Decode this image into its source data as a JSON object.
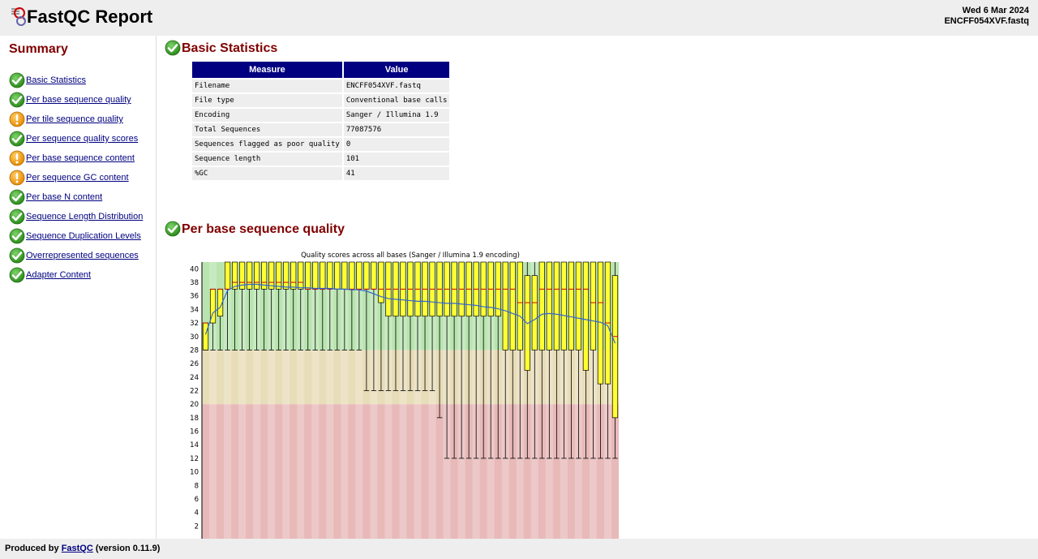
{
  "header": {
    "title": "FastQC Report",
    "date": "Wed 6 Mar 2024",
    "filename": "ENCFF054XVF.fastq"
  },
  "summary": {
    "title": "Summary",
    "items": [
      {
        "label": "Basic Statistics",
        "status": "pass"
      },
      {
        "label": "Per base sequence quality",
        "status": "pass"
      },
      {
        "label": "Per tile sequence quality",
        "status": "warn"
      },
      {
        "label": "Per sequence quality scores",
        "status": "pass"
      },
      {
        "label": "Per base sequence content",
        "status": "warn"
      },
      {
        "label": "Per sequence GC content",
        "status": "warn"
      },
      {
        "label": "Per base N content",
        "status": "pass"
      },
      {
        "label": "Sequence Length Distribution",
        "status": "pass"
      },
      {
        "label": "Sequence Duplication Levels",
        "status": "pass"
      },
      {
        "label": "Overrepresented sequences",
        "status": "pass"
      },
      {
        "label": "Adapter Content",
        "status": "pass"
      }
    ]
  },
  "basic_statistics": {
    "title": "Basic Statistics",
    "headers": [
      "Measure",
      "Value"
    ],
    "rows": [
      [
        "Filename",
        "ENCFF054XVF.fastq"
      ],
      [
        "File type",
        "Conventional base calls"
      ],
      [
        "Encoding",
        "Sanger / Illumina 1.9"
      ],
      [
        "Total Sequences",
        "77087576"
      ],
      [
        "Sequences flagged as poor quality",
        "0"
      ],
      [
        "Sequence length",
        "101"
      ],
      [
        "%GC",
        "41"
      ]
    ]
  },
  "per_base_quality": {
    "title": "Per base sequence quality"
  },
  "chart_data": {
    "type": "box",
    "title": "Quality scores across all bases (Sanger / Illumina 1.9 encoding)",
    "y_ticks": [
      2,
      4,
      6,
      8,
      10,
      12,
      14,
      16,
      18,
      20,
      22,
      24,
      26,
      28,
      30,
      32,
      34,
      36,
      38,
      40
    ],
    "ylim": [
      0,
      41
    ],
    "zones": [
      {
        "from": 28,
        "to": 41,
        "color": "#b9e4b0"
      },
      {
        "from": 20,
        "to": 28,
        "color": "#e8ddb9"
      },
      {
        "from": 0,
        "to": 20,
        "color": "#e8b9b9"
      }
    ],
    "box_color": "#ffff33",
    "median_color": "#cc0000",
    "mean_color": "#3366cc",
    "positions": [
      {
        "lo": 28,
        "q1": 28,
        "med": 32,
        "q3": 32,
        "hi": 32,
        "mean": 30.3
      },
      {
        "lo": 28,
        "q1": 32,
        "med": 37,
        "q3": 37,
        "hi": 37,
        "mean": 33.5
      },
      {
        "lo": 28,
        "q1": 33,
        "med": 37,
        "q3": 37,
        "hi": 37,
        "mean": 34.3
      },
      {
        "lo": 28,
        "q1": 37,
        "med": 37,
        "q3": 41,
        "hi": 41,
        "mean": 36.8
      },
      {
        "lo": 28,
        "q1": 37,
        "med": 38,
        "q3": 41,
        "hi": 41,
        "mean": 37.4
      },
      {
        "lo": 28,
        "q1": 37,
        "med": 38,
        "q3": 41,
        "hi": 41,
        "mean": 37.6
      },
      {
        "lo": 28,
        "q1": 37,
        "med": 38,
        "q3": 41,
        "hi": 41,
        "mean": 37.7
      },
      {
        "lo": 28,
        "q1": 37,
        "med": 38,
        "q3": 41,
        "hi": 41,
        "mean": 37.7
      },
      {
        "lo": 28,
        "q1": 37,
        "med": 38,
        "q3": 41,
        "hi": 41,
        "mean": 37.6
      },
      {
        "lo": 28,
        "q1": 37,
        "med": 38,
        "q3": 41,
        "hi": 41,
        "mean": 37.5
      },
      {
        "lo": 28,
        "q1": 37,
        "med": 38,
        "q3": 41,
        "hi": 41,
        "mean": 37.4
      },
      {
        "lo": 28,
        "q1": 37,
        "med": 38,
        "q3": 41,
        "hi": 41,
        "mean": 37.3
      },
      {
        "lo": 28,
        "q1": 37,
        "med": 38,
        "q3": 41,
        "hi": 41,
        "mean": 37.3
      },
      {
        "lo": 28,
        "q1": 37,
        "med": 38,
        "q3": 41,
        "hi": 41,
        "mean": 37.2
      },
      {
        "lo": 28,
        "q1": 37,
        "med": 37,
        "q3": 41,
        "hi": 41,
        "mean": 37.2
      },
      {
        "lo": 28,
        "q1": 37,
        "med": 37,
        "q3": 41,
        "hi": 41,
        "mean": 37.1
      },
      {
        "lo": 28,
        "q1": 37,
        "med": 37,
        "q3": 41,
        "hi": 41,
        "mean": 37.1
      },
      {
        "lo": 28,
        "q1": 37,
        "med": 37,
        "q3": 41,
        "hi": 41,
        "mean": 37.1
      },
      {
        "lo": 28,
        "q1": 37,
        "med": 37,
        "q3": 41,
        "hi": 41,
        "mean": 37.0
      },
      {
        "lo": 28,
        "q1": 37,
        "med": 37,
        "q3": 41,
        "hi": 41,
        "mean": 37.0
      },
      {
        "lo": 28,
        "q1": 37,
        "med": 37,
        "q3": 41,
        "hi": 41,
        "mean": 36.9
      },
      {
        "lo": 28,
        "q1": 37,
        "med": 37,
        "q3": 41,
        "hi": 41,
        "mean": 36.9
      },
      {
        "lo": 22,
        "q1": 37,
        "med": 37,
        "q3": 41,
        "hi": 41,
        "mean": 36.7
      },
      {
        "lo": 22,
        "q1": 37,
        "med": 37,
        "q3": 41,
        "hi": 41,
        "mean": 36.3
      },
      {
        "lo": 22,
        "q1": 35,
        "med": 37,
        "q3": 41,
        "hi": 41,
        "mean": 35.9
      },
      {
        "lo": 22,
        "q1": 33,
        "med": 37,
        "q3": 41,
        "hi": 41,
        "mean": 35.6
      },
      {
        "lo": 22,
        "q1": 33,
        "med": 37,
        "q3": 41,
        "hi": 41,
        "mean": 35.5
      },
      {
        "lo": 22,
        "q1": 33,
        "med": 37,
        "q3": 41,
        "hi": 41,
        "mean": 35.4
      },
      {
        "lo": 22,
        "q1": 33,
        "med": 37,
        "q3": 41,
        "hi": 41,
        "mean": 35.3
      },
      {
        "lo": 22,
        "q1": 33,
        "med": 37,
        "q3": 41,
        "hi": 41,
        "mean": 35.2
      },
      {
        "lo": 22,
        "q1": 33,
        "med": 37,
        "q3": 41,
        "hi": 41,
        "mean": 35.2
      },
      {
        "lo": 22,
        "q1": 33,
        "med": 37,
        "q3": 41,
        "hi": 41,
        "mean": 35.1
      },
      {
        "lo": 18,
        "q1": 33,
        "med": 37,
        "q3": 41,
        "hi": 41,
        "mean": 35.0
      },
      {
        "lo": 12,
        "q1": 33,
        "med": 37,
        "q3": 41,
        "hi": 41,
        "mean": 34.9
      },
      {
        "lo": 12,
        "q1": 33,
        "med": 37,
        "q3": 41,
        "hi": 41,
        "mean": 34.9
      },
      {
        "lo": 12,
        "q1": 33,
        "med": 37,
        "q3": 41,
        "hi": 41,
        "mean": 34.8
      },
      {
        "lo": 12,
        "q1": 33,
        "med": 37,
        "q3": 41,
        "hi": 41,
        "mean": 34.7
      },
      {
        "lo": 12,
        "q1": 33,
        "med": 37,
        "q3": 41,
        "hi": 41,
        "mean": 34.6
      },
      {
        "lo": 12,
        "q1": 33,
        "med": 37,
        "q3": 41,
        "hi": 41,
        "mean": 34.4
      },
      {
        "lo": 12,
        "q1": 33,
        "med": 37,
        "q3": 41,
        "hi": 41,
        "mean": 34.3
      },
      {
        "lo": 12,
        "q1": 33,
        "med": 37,
        "q3": 41,
        "hi": 41,
        "mean": 34.1
      },
      {
        "lo": 12,
        "q1": 28,
        "med": 37,
        "q3": 41,
        "hi": 41,
        "mean": 33.8
      },
      {
        "lo": 12,
        "q1": 28,
        "med": 37,
        "q3": 41,
        "hi": 41,
        "mean": 33.4
      },
      {
        "lo": 12,
        "q1": 28,
        "med": 35,
        "q3": 41,
        "hi": 41,
        "mean": 33.0
      },
      {
        "lo": 12,
        "q1": 25,
        "med": 35,
        "q3": 39,
        "hi": 41,
        "mean": 31.9
      },
      {
        "lo": 12,
        "q1": 28,
        "med": 35,
        "q3": 39,
        "hi": 41,
        "mean": 32.5
      },
      {
        "lo": 12,
        "q1": 28,
        "med": 37,
        "q3": 41,
        "hi": 41,
        "mean": 33.3
      },
      {
        "lo": 12,
        "q1": 28,
        "med": 37,
        "q3": 41,
        "hi": 41,
        "mean": 33.4
      },
      {
        "lo": 12,
        "q1": 28,
        "med": 37,
        "q3": 41,
        "hi": 41,
        "mean": 33.3
      },
      {
        "lo": 12,
        "q1": 28,
        "med": 37,
        "q3": 41,
        "hi": 41,
        "mean": 33.1
      },
      {
        "lo": 12,
        "q1": 28,
        "med": 37,
        "q3": 41,
        "hi": 41,
        "mean": 32.9
      },
      {
        "lo": 12,
        "q1": 28,
        "med": 37,
        "q3": 41,
        "hi": 41,
        "mean": 32.7
      },
      {
        "lo": 12,
        "q1": 25,
        "med": 37,
        "q3": 41,
        "hi": 41,
        "mean": 32.5
      },
      {
        "lo": 12,
        "q1": 28,
        "med": 35,
        "q3": 41,
        "hi": 41,
        "mean": 32.3
      },
      {
        "lo": 12,
        "q1": 23,
        "med": 35,
        "q3": 41,
        "hi": 41,
        "mean": 32.1
      },
      {
        "lo": 12,
        "q1": 23,
        "med": 32,
        "q3": 41,
        "hi": 41,
        "mean": 31.6
      },
      {
        "lo": 12,
        "q1": 18,
        "med": 30,
        "q3": 39,
        "hi": 41,
        "mean": 29.0
      }
    ]
  },
  "footer": {
    "prefix": "Produced by ",
    "link": "FastQC",
    "suffix": " (version 0.11.9)"
  }
}
